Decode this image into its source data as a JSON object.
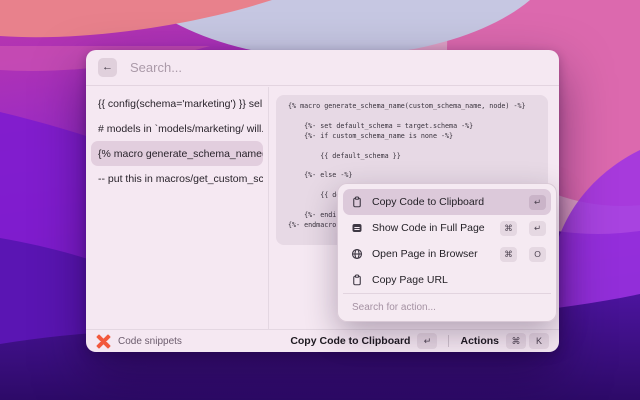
{
  "wallpaper": {
    "style": "macos-monterey-abstract-waves",
    "palette": [
      "#e8818c",
      "#bd37ab",
      "#c6c7e2",
      "#dc69ae",
      "#8d27cd",
      "#7e1cce",
      "#5a15b3",
      "#9d33e4",
      "#44118f",
      "#2d0a68"
    ]
  },
  "window": {
    "search": {
      "placeholder": "Search..."
    },
    "back_icon": "←",
    "snippet_list": {
      "items": [
        {
          "label": "{{ config(schema='marketing') }}  sel...",
          "selected": false
        },
        {
          "label": "# models in `models/marketing/ will...",
          "selected": false
        },
        {
          "label": "{% macro generate_schema_name(c...",
          "selected": true
        },
        {
          "label": "-- put this in macros/get_custom_sc...",
          "selected": false
        }
      ]
    },
    "code_preview": {
      "code": "{% macro generate_schema_name(custom_schema_name, node) -%}\n\n    {%- set default_schema = target.schema -%}\n    {%- if custom_schema_name is none -%}\n\n        {{ default_schema }}\n\n    {%- else -%}\n\n        {{ de\n\n    {%- endi\n{%- endmacro"
    },
    "action_menu": {
      "items": [
        {
          "icon": "clipboard-icon",
          "label": "Copy Code to Clipboard",
          "keys": [
            "↵"
          ],
          "selected": true
        },
        {
          "icon": "app-window-icon",
          "label": "Show Code in Full Page",
          "keys": [
            "⌘",
            "↵"
          ],
          "selected": false
        },
        {
          "icon": "globe-icon",
          "label": "Open Page in Browser",
          "keys": [
            "⌘",
            "O"
          ],
          "selected": false
        },
        {
          "icon": "clipboard-icon",
          "label": "Copy Page URL",
          "keys": [],
          "selected": false
        }
      ],
      "search_placeholder": "Search for action..."
    },
    "status_bar": {
      "extension_name": "Code snippets",
      "primary_action_label": "Copy Code to Clipboard",
      "primary_action_key": "↵",
      "actions_label": "Actions",
      "actions_keys": [
        "⌘",
        "K"
      ]
    }
  },
  "colors": {
    "logo_orange": "#f2593d",
    "list_selection": "#e2cede",
    "menu_selection": "#dcc9da",
    "window_bg": "#f5e8f2"
  }
}
